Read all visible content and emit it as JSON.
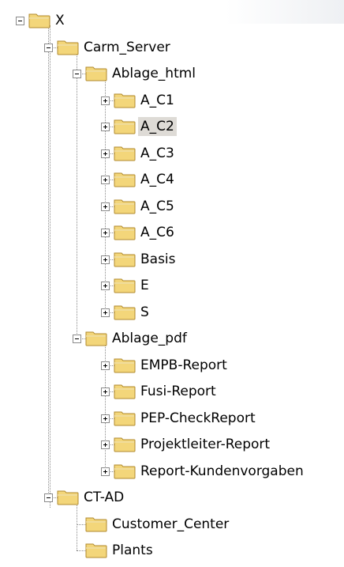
{
  "tree": {
    "root": {
      "label": "X",
      "children": [
        {
          "label": "Carm_Server",
          "children": [
            {
              "label": "Ablage_html",
              "children": [
                {
                  "label": "A_C1"
                },
                {
                  "label": "A_C2",
                  "selected": true
                },
                {
                  "label": "A_C3"
                },
                {
                  "label": "A_C4"
                },
                {
                  "label": "A_C5"
                },
                {
                  "label": "A_C6"
                },
                {
                  "label": "Basis"
                },
                {
                  "label": "E"
                },
                {
                  "label": "S"
                }
              ]
            },
            {
              "label": "Ablage_pdf",
              "children": [
                {
                  "label": "EMPB-Report"
                },
                {
                  "label": "Fusi-Report"
                },
                {
                  "label": "PEP-CheckReport"
                },
                {
                  "label": "Projektleiter-Report"
                },
                {
                  "label": "Report-Kundenvorgaben"
                }
              ]
            }
          ]
        },
        {
          "label": "CT-AD",
          "children": [
            {
              "label": "Customer_Center",
              "leaf": true
            },
            {
              "label": "Plants",
              "leaf": true
            }
          ]
        }
      ]
    }
  },
  "colors": {
    "folder_fill": "#f3d67a",
    "folder_edge": "#b08a2e",
    "selection": "#dedbd6",
    "connector": "#8c8c8c"
  },
  "icons": {
    "folder": "folder-icon",
    "expanded": "collapse-icon",
    "collapsed": "expand-icon"
  }
}
